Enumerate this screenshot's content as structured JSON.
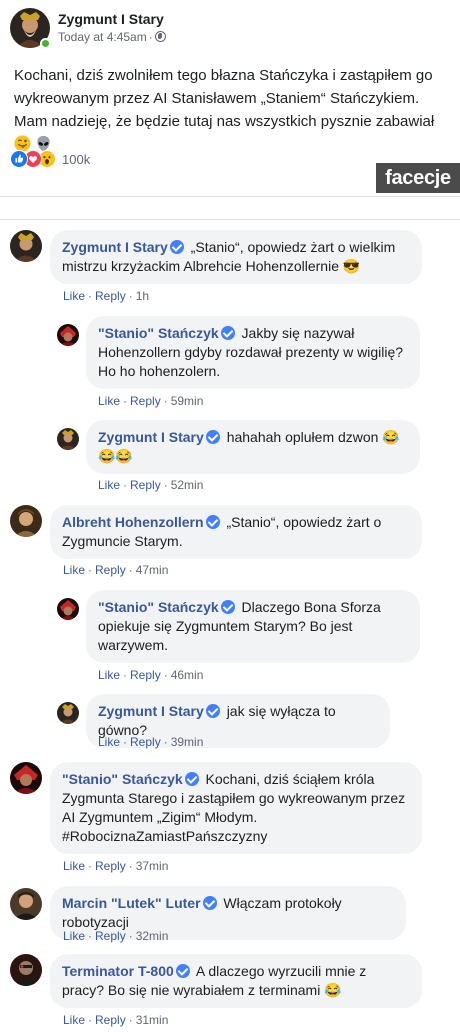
{
  "post": {
    "author": "Zygmunt I Stary",
    "time": "Today at 4:45am",
    "separator": "·",
    "text_before_emoji": "Kochani, dziś zwolniłem tego błazna Stańczyka i zastąpiłem go wykreowanym przez AI Stanisławem „Staniem“ Stańczykiem. Mam nadzieję, że będzie tutaj nas wszystkich pysznie zabawiał ",
    "emojis": [
      "winking-face-with-tongue",
      "alien"
    ],
    "reactions": [
      "like",
      "love",
      "wow"
    ],
    "reaction_count": "100k"
  },
  "watermark": "facecje",
  "actions": {
    "like": "Like",
    "reply": "Reply",
    "dot": "·"
  },
  "comments": [
    {
      "author": "Zygmunt I Stary",
      "text": "„Stanio“, opowiedz żart o wielkim mistrzu krzyżackim Albrehcie Hohenzollernie 😎",
      "time": "1h"
    },
    {
      "author": "\"Stanio\" Stańczyk",
      "text": "Jakby się nazywał Hohenzollern gdyby rozdawał prezenty w wigilię? Ho ho hohenzolern.",
      "time": "59min"
    },
    {
      "author": "Zygmunt I Stary",
      "text": "hahahah oplułem dzwon 😂😂😂",
      "time": "52min"
    },
    {
      "author": "Albreht Hohenzollern",
      "text": "„Stanio“, opowiedz żart o Zygmuncie Starym.",
      "time": "47min"
    },
    {
      "author": "\"Stanio\" Stańczyk",
      "text": "Dlaczego Bona Sforza opiekuje się Zygmuntem Starym? Bo jest warzywem.",
      "time": "46min"
    },
    {
      "author": "Zygmunt I Stary",
      "text": "jak się wyłącza to gówno?",
      "time": "39min"
    },
    {
      "author": "\"Stanio\" Stańczyk",
      "text": "Kochani, dziś ściąłem króla Zygmunta Starego i zastąpiłem go wykreowanym przez AI Zygmuntem „Zigim“ Młodym. #RobociznaZamiastPańszczyzny",
      "time": "37min"
    },
    {
      "author": "Marcin \"Lutek\" Luter",
      "text": "Włączam protokoły robotyzacji",
      "time": "32min"
    },
    {
      "author": "Terminator T-800",
      "text": "A dlaczego wyrzucili mnie z pracy? Bo się nie wyrabiałem z terminami 😂",
      "time": "31min"
    }
  ]
}
